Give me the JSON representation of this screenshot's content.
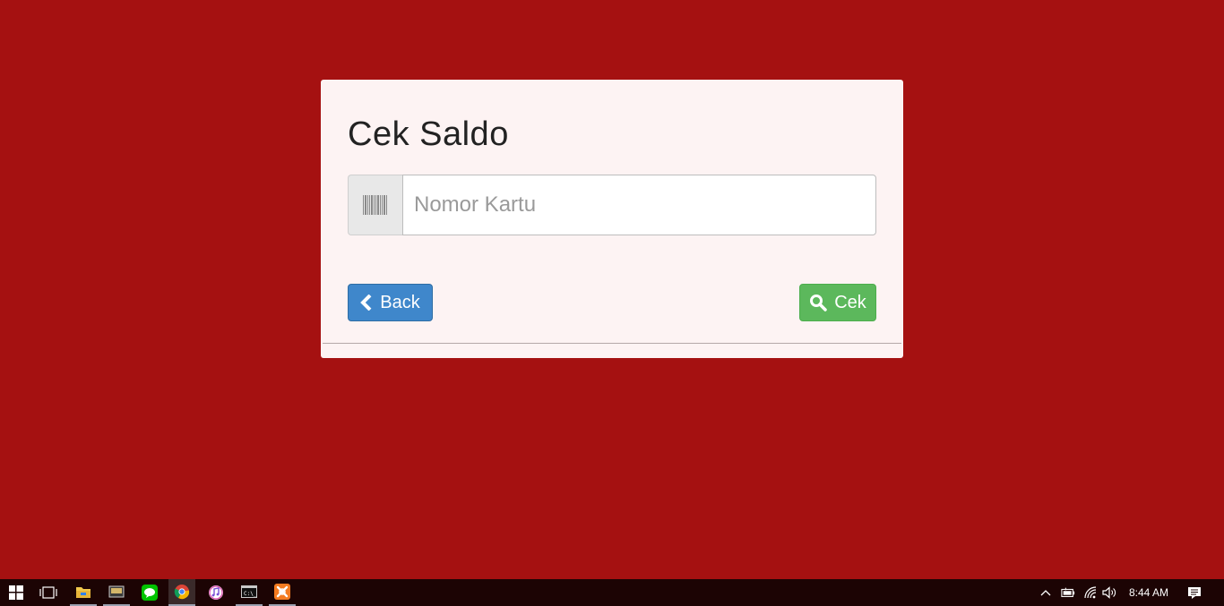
{
  "card": {
    "title": "Cek Saldo",
    "card_number_placeholder": "Nomor Kartu",
    "card_number_value": "",
    "back_label": "Back",
    "check_label": "Cek"
  },
  "colors": {
    "background": "#a51111",
    "card": "#fdf3f3",
    "back_button": "#3f87cb",
    "check_button": "#5cb85c",
    "taskbar": "#1c0404"
  },
  "taskbar": {
    "apps": [
      {
        "name": "file-explorer-icon"
      },
      {
        "name": "app-icon"
      },
      {
        "name": "line-icon"
      },
      {
        "name": "chrome-icon"
      },
      {
        "name": "itunes-icon"
      },
      {
        "name": "command-prompt-icon"
      },
      {
        "name": "xampp-icon"
      }
    ],
    "clock": "8:44 AM"
  }
}
